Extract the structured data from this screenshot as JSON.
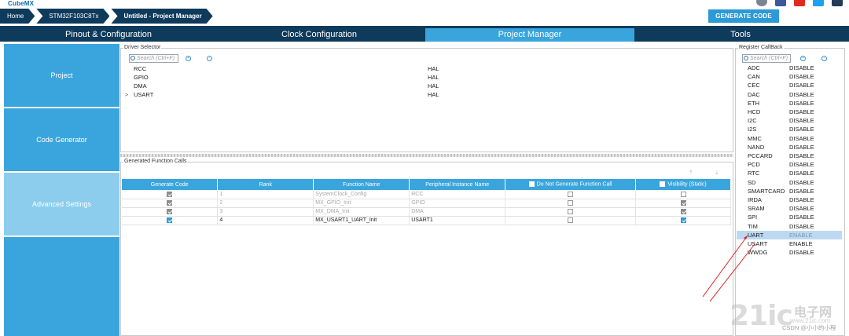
{
  "app": {
    "logo": "CubeMX"
  },
  "breadcrumb": [
    {
      "label": "Home"
    },
    {
      "label": "STM32F103C8Tx"
    },
    {
      "label": "Untitled - Project Manager"
    }
  ],
  "generate_code_label": "GENERATE CODE",
  "tabs": [
    {
      "label": "Pinout & Configuration"
    },
    {
      "label": "Clock Configuration"
    },
    {
      "label": "Project Manager"
    },
    {
      "label": "Tools"
    }
  ],
  "sidebar": {
    "items": [
      {
        "label": "Project"
      },
      {
        "label": "Code Generator"
      },
      {
        "label": "Advanced Settings"
      }
    ]
  },
  "driver_selector": {
    "legend": "Driver Selector",
    "search_placeholder": "Search (Ctrl+F)",
    "rows": [
      {
        "name": "RCC",
        "value": "HAL"
      },
      {
        "name": "GPIO",
        "value": "HAL"
      },
      {
        "name": "DMA",
        "value": "HAL"
      },
      {
        "name": "USART",
        "value": "HAL",
        "expander": ">"
      }
    ]
  },
  "function_calls": {
    "legend": "Generated Function Calls",
    "sort_up": "⇡",
    "sort_down": "⇣",
    "headers": [
      "Generate Code",
      "Rank",
      "Function Name",
      "Peripheral Instance Name",
      "Do Not Generate Function Call",
      "Visibility (Static)"
    ],
    "rows": [
      {
        "generate": true,
        "rank": "1",
        "function": "SystemClock_Config",
        "instance": "RCC",
        "do_not_generate": false,
        "visibility": false,
        "disabled": true
      },
      {
        "generate": true,
        "rank": "2",
        "function": "MX_GPIO_Init",
        "instance": "GPIO",
        "do_not_generate": false,
        "visibility": true,
        "disabled": true
      },
      {
        "generate": true,
        "rank": "3",
        "function": "MX_DMA_Init",
        "instance": "DMA",
        "do_not_generate": false,
        "visibility": true,
        "disabled": true
      },
      {
        "generate": true,
        "rank": "4",
        "function": "MX_USART1_UART_Init",
        "instance": "USART1",
        "do_not_generate": false,
        "visibility": true,
        "disabled": false
      }
    ]
  },
  "register_callback": {
    "legend": "Register CallBack",
    "search_placeholder": "Search (Ctrl+F)",
    "rows": [
      {
        "name": "ADC",
        "value": "DISABLE"
      },
      {
        "name": "CAN",
        "value": "DISABLE"
      },
      {
        "name": "CEC",
        "value": "DISABLE"
      },
      {
        "name": "DAC",
        "value": "DISABLE"
      },
      {
        "name": "ETH",
        "value": "DISABLE"
      },
      {
        "name": "HCD",
        "value": "DISABLE"
      },
      {
        "name": "I2C",
        "value": "DISABLE"
      },
      {
        "name": "I2S",
        "value": "DISABLE"
      },
      {
        "name": "MMC",
        "value": "DISABLE"
      },
      {
        "name": "NAND",
        "value": "DISABLE"
      },
      {
        "name": "PCCARD",
        "value": "DISABLE"
      },
      {
        "name": "PCD",
        "value": "DISABLE"
      },
      {
        "name": "RTC",
        "value": "DISABLE"
      },
      {
        "name": "SD",
        "value": "DISABLE"
      },
      {
        "name": "SMARTCARD",
        "value": "DISABLE"
      },
      {
        "name": "IRDA",
        "value": "DISABLE"
      },
      {
        "name": "SRAM",
        "value": "DISABLE"
      },
      {
        "name": "SPI",
        "value": "DISABLE"
      },
      {
        "name": "TIM",
        "value": "DISABLE"
      },
      {
        "name": "UART",
        "value": "ENABLE",
        "selected": true
      },
      {
        "name": "USART",
        "value": "ENABLE"
      },
      {
        "name": "WWDG",
        "value": "DISABLE"
      }
    ]
  },
  "watermark": {
    "brand": "21ic",
    "cn": "电子网",
    "url": "www.21ic.com",
    "csdn": "CSDN @小小的小程"
  },
  "colors": {
    "navy": "#0e3a5c",
    "accent": "#3aa5dc",
    "annotation": "#e02020"
  }
}
